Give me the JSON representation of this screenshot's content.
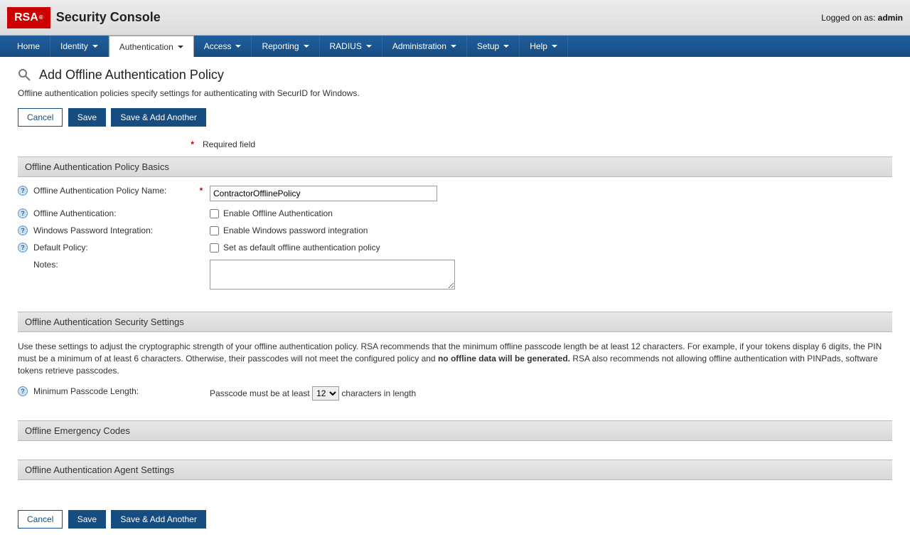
{
  "header": {
    "logo_text": "RSA",
    "console_title": "Security Console",
    "logged_on_prefix": "Logged on as: ",
    "logged_on_user": "admin"
  },
  "nav": {
    "items": [
      {
        "label": "Home",
        "dropdown": false,
        "active": false
      },
      {
        "label": "Identity",
        "dropdown": true,
        "active": false
      },
      {
        "label": "Authentication",
        "dropdown": true,
        "active": true
      },
      {
        "label": "Access",
        "dropdown": true,
        "active": false
      },
      {
        "label": "Reporting",
        "dropdown": true,
        "active": false
      },
      {
        "label": "RADIUS",
        "dropdown": true,
        "active": false
      },
      {
        "label": "Administration",
        "dropdown": true,
        "active": false
      },
      {
        "label": "Setup",
        "dropdown": true,
        "active": false
      },
      {
        "label": "Help",
        "dropdown": true,
        "active": false
      }
    ]
  },
  "page": {
    "title": "Add Offline Authentication Policy",
    "description": "Offline authentication policies specify settings for authenticating with SecurID for Windows.",
    "buttons": {
      "cancel": "Cancel",
      "save": "Save",
      "save_add": "Save & Add Another"
    },
    "required_label": "Required field"
  },
  "basics": {
    "header": "Offline Authentication Policy Basics",
    "name_label": "Offline Authentication Policy Name:",
    "name_value": "ContractorOfflinePolicy",
    "offline_auth_label": "Offline Authentication:",
    "offline_auth_checkbox": "Enable Offline Authentication",
    "win_pass_label": "Windows Password Integration:",
    "win_pass_checkbox": "Enable Windows password integration",
    "default_label": "Default Policy:",
    "default_checkbox": "Set as default offline authentication policy",
    "notes_label": "Notes:",
    "notes_value": ""
  },
  "security": {
    "header": "Offline Authentication Security Settings",
    "desc_before": "Use these settings to adjust the cryptographic strength of your offline authentication policy. RSA recommends that the minimum offline passcode length be at least 12 characters. For example, if your tokens display 6 digits, the PIN must be a minimum of at least 6 characters. Otherwise, their passcodes will not meet the configured policy and ",
    "desc_bold": "no offline data will be generated.",
    "desc_after": " RSA also recommends not allowing offline authentication with PINPads, software tokens retrieve passcodes.",
    "min_passcode_label": "Minimum Passcode Length:",
    "passcode_prefix": "Passcode must be at least ",
    "passcode_value": "12",
    "passcode_suffix": " characters in length"
  },
  "emergency": {
    "header": "Offline Emergency Codes"
  },
  "agent": {
    "header": "Offline Authentication Agent Settings"
  }
}
